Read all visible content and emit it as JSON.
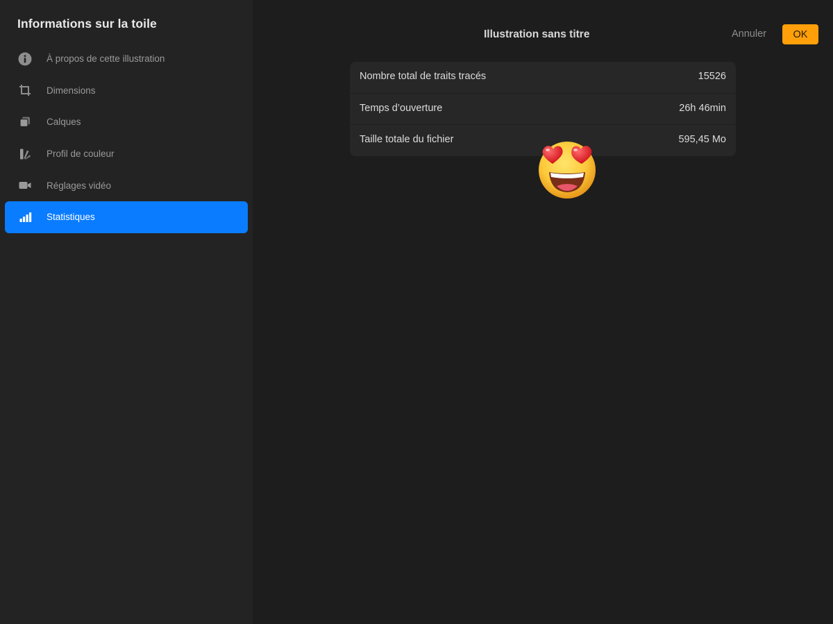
{
  "sidebar": {
    "title": "Informations sur la toile",
    "items": [
      {
        "label": "À propos de cette illustration",
        "icon": "info-icon",
        "active": false
      },
      {
        "label": "Dimensions",
        "icon": "crop-icon",
        "active": false
      },
      {
        "label": "Calques",
        "icon": "layers-icon",
        "active": false
      },
      {
        "label": "Profil de couleur",
        "icon": "color-profile-icon",
        "active": false
      },
      {
        "label": "Réglages vidéo",
        "icon": "video-camera-icon",
        "active": false
      },
      {
        "label": "Statistiques",
        "icon": "bar-chart-icon",
        "active": true
      }
    ]
  },
  "header": {
    "title": "Illustration sans titre",
    "cancel_label": "Annuler",
    "ok_label": "OK"
  },
  "stats": {
    "rows": [
      {
        "label": "Nombre total de traits tracés",
        "value": "15526"
      },
      {
        "label": "Temps d’ouverture",
        "value": "26h 46min"
      },
      {
        "label": "Taille totale du fichier",
        "value": "595,45 Mo"
      }
    ]
  },
  "sticker": {
    "icon": "heart-eyes-emoji-icon"
  },
  "colors": {
    "accent_blue": "#0a7cff",
    "ok_orange": "#ff9f0a",
    "sidebar_bg": "#232323",
    "main_bg": "#1d1d1d",
    "card_bg": "#272727"
  }
}
